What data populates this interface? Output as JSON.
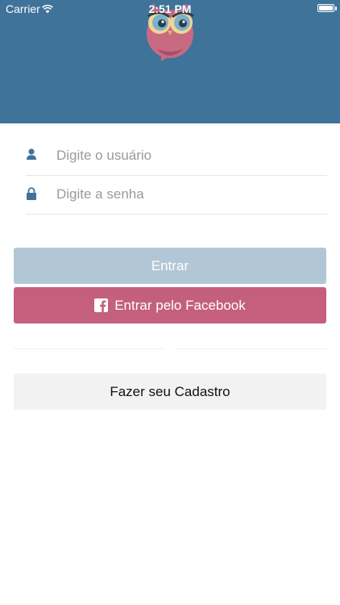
{
  "status_bar": {
    "carrier": "Carrier",
    "time": "2:51 PM"
  },
  "colors": {
    "header": "#3f7399",
    "login_button": "#b2c7d6",
    "facebook_button": "#c45f7e",
    "signup_button": "#f2f2f2"
  },
  "login_form": {
    "username_placeholder": "Digite o usuário",
    "password_placeholder": "Digite a senha",
    "username_icon": "user-icon",
    "password_icon": "lock-icon"
  },
  "buttons": {
    "login_label": "Entrar",
    "facebook_label": "Entrar pelo Facebook",
    "signup_label": "Fazer seu Cadastro"
  }
}
